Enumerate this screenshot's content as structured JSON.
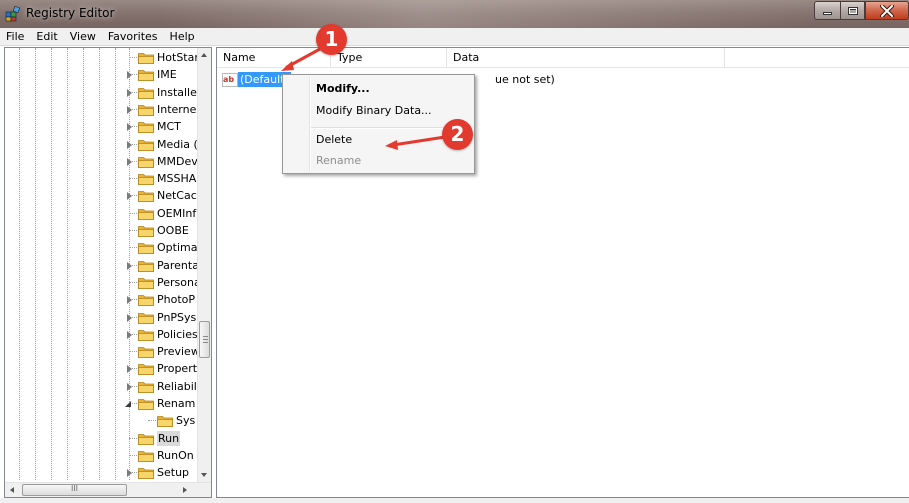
{
  "window": {
    "title": "Registry Editor",
    "icon": "regedit-icon"
  },
  "menu": [
    "File",
    "Edit",
    "View",
    "Favorites",
    "Help"
  ],
  "tree": {
    "items": [
      {
        "label": "HotStar",
        "expandable": false
      },
      {
        "label": "IME",
        "expandable": true
      },
      {
        "label": "Installe",
        "expandable": true
      },
      {
        "label": "Interne",
        "expandable": true
      },
      {
        "label": "MCT",
        "expandable": true
      },
      {
        "label": "Media (",
        "expandable": true
      },
      {
        "label": "MMDev",
        "expandable": true
      },
      {
        "label": "MSSHA",
        "expandable": false
      },
      {
        "label": "NetCac",
        "expandable": true
      },
      {
        "label": "OEMInf",
        "expandable": false
      },
      {
        "label": "OOBE",
        "expandable": false
      },
      {
        "label": "Optima",
        "expandable": false
      },
      {
        "label": "Parenta",
        "expandable": true
      },
      {
        "label": "Persona",
        "expandable": false
      },
      {
        "label": "PhotoP",
        "expandable": true
      },
      {
        "label": "PnPSys",
        "expandable": true
      },
      {
        "label": "Policies",
        "expandable": true
      },
      {
        "label": "Preview",
        "expandable": false
      },
      {
        "label": "Propert",
        "expandable": true
      },
      {
        "label": "Reliabil",
        "expandable": true
      },
      {
        "label": "Renam",
        "expandable": true,
        "expanded": true
      },
      {
        "label": "Sys",
        "child": true
      },
      {
        "label": "Run",
        "selected": true
      },
      {
        "label": "RunOn",
        "expandable": false
      },
      {
        "label": "Setup",
        "expandable": true
      }
    ],
    "hscroll_grip": "III"
  },
  "values": {
    "columns": {
      "name": "Name",
      "type": "Type",
      "data": "Data"
    },
    "rows": [
      {
        "name": "(Default)",
        "data": "ue not set)",
        "icon": "string-value-icon"
      }
    ]
  },
  "context_menu": {
    "modify": "Modify...",
    "modify_binary": "Modify Binary Data...",
    "delete": "Delete",
    "rename": "Rename"
  },
  "annotations": {
    "step1": "1",
    "step2": "2",
    "color": "#e23a2f"
  }
}
